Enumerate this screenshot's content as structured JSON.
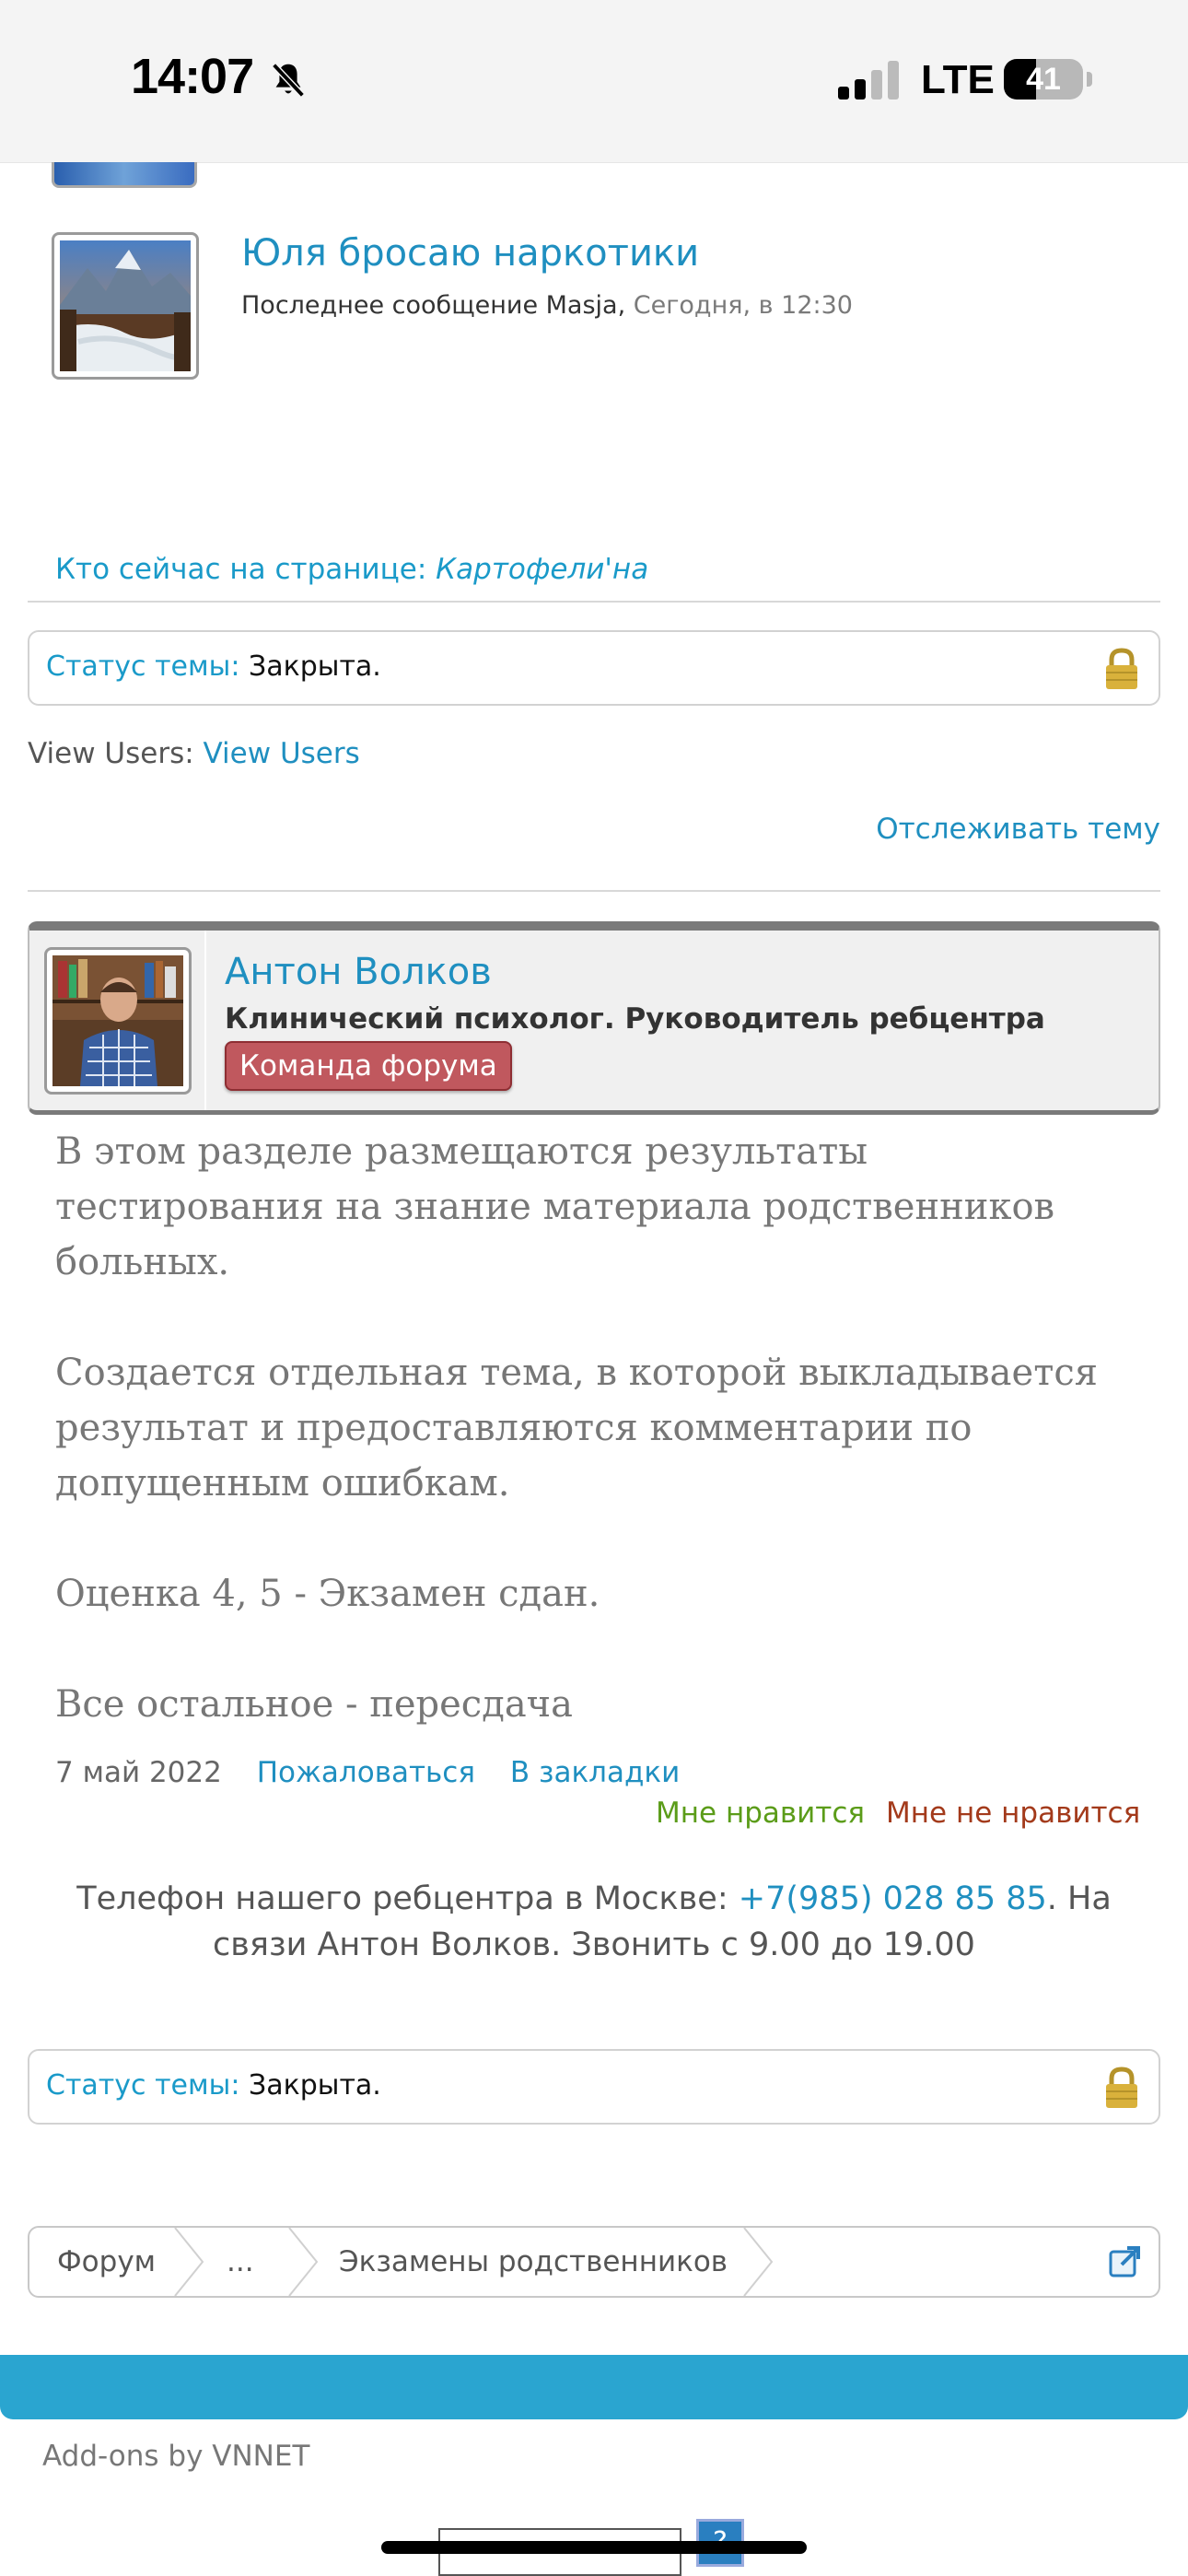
{
  "status_bar": {
    "time": "14:07",
    "network": "LTE",
    "battery": "41",
    "battery_level": 0.41,
    "icons": [
      "bell-slash-icon",
      "signal-icon",
      "battery-icon"
    ]
  },
  "thread_list": {
    "item": {
      "title": "Юля бросаю наркотики",
      "meta_prefix": "Последнее сообщение Masja,",
      "meta_time": "Сегодня, в 12:30"
    }
  },
  "viewing": {
    "label": "Кто сейчас на странице:",
    "user": "Картофели'на"
  },
  "thread_status": {
    "label": "Статус темы:",
    "value": "Закрыта.",
    "icon": "lock-icon"
  },
  "view_users": {
    "label": "View Users:",
    "link": "View Users"
  },
  "watch_thread": "Отслеживать тему",
  "post": {
    "author_name": "Антон Волков",
    "author_title": "Клинический психолог. Руководитель ребцентра",
    "author_badge": "Команда форума",
    "paragraphs": [
      "В этом разделе размещаются результаты тестирования на знание материала родственников больных.",
      "Создается отдельная тема, в которой выкладывается результат и предоставляются комментарии по допущенным ошибкам.",
      "Оценка 4, 5 - Экзамен сдан.",
      "Все остальное - пересдача"
    ],
    "date": "7 май 2022",
    "report_link": "Пожаловаться",
    "bookmark_link": "В закладки",
    "like": "Мне нравится",
    "dislike": "Мне не нравится"
  },
  "phone_note": {
    "prefix": "Телефон нашего ребцентра в Москве:",
    "phone": "+7(985) 028 85 85",
    "suffix": ". На связи Антон Волков. Звонить с 9.00 до 19.00"
  },
  "breadcrumb": {
    "items": [
      "Форум",
      "...",
      "Экзамены родственников"
    ],
    "jump_icon": "jump-icon"
  },
  "footer": {
    "addons": "Add-ons by VNNET",
    "help": "?"
  },
  "colors": {
    "link": "#1f8fc0",
    "accent_bar": "#2aa5d0",
    "like": "#5b9c19",
    "dislike": "#a33a1b",
    "badge": "#c0585e"
  }
}
